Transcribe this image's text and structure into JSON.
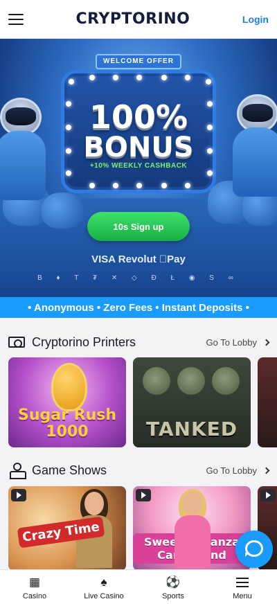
{
  "header": {
    "logo": "CRYPTORINO",
    "login_label": "Login",
    "menu_icon": "hamburger-icon"
  },
  "hero": {
    "welcome_badge": "WELCOME OFFER",
    "bonus_percent": "100%",
    "bonus_word": "BONUS",
    "cashback": "+10% WEEKLY CASHBACK",
    "signup_label": "10s Sign up",
    "payments": "VISA  Revolut  Pay",
    "coins": "B ♦ T ₮ ✕ ◇ Đ Ł ◉ S ∞"
  },
  "strip": {
    "text": "• Anonymous • Zero Fees • Instant Deposits •"
  },
  "sections": {
    "printers": {
      "title": "Cryptorino Printers",
      "link": "Go To Lobby",
      "icon": "money-printer-icon",
      "games": [
        {
          "title": "Sugar Rush 1000"
        },
        {
          "title": "TANKED"
        }
      ]
    },
    "shows": {
      "title": "Game Shows",
      "link": "Go To Lobby",
      "icon": "game-show-host-icon",
      "games": [
        {
          "title": "Crazy Time"
        },
        {
          "title": "Sweet Bonanza CandyLand"
        }
      ]
    }
  },
  "chat": {
    "icon": "chat-icon"
  },
  "bottom_nav": [
    {
      "label": "Casino",
      "icon": "slot-machine-icon"
    },
    {
      "label": "Live Casino",
      "icon": "cards-icon"
    },
    {
      "label": "Sports",
      "icon": "basketball-icon"
    },
    {
      "label": "Menu",
      "icon": "menu-icon"
    }
  ],
  "colors": {
    "accent": "#1a9bff",
    "signup": "#22c14f",
    "login": "#1f7fe0"
  }
}
